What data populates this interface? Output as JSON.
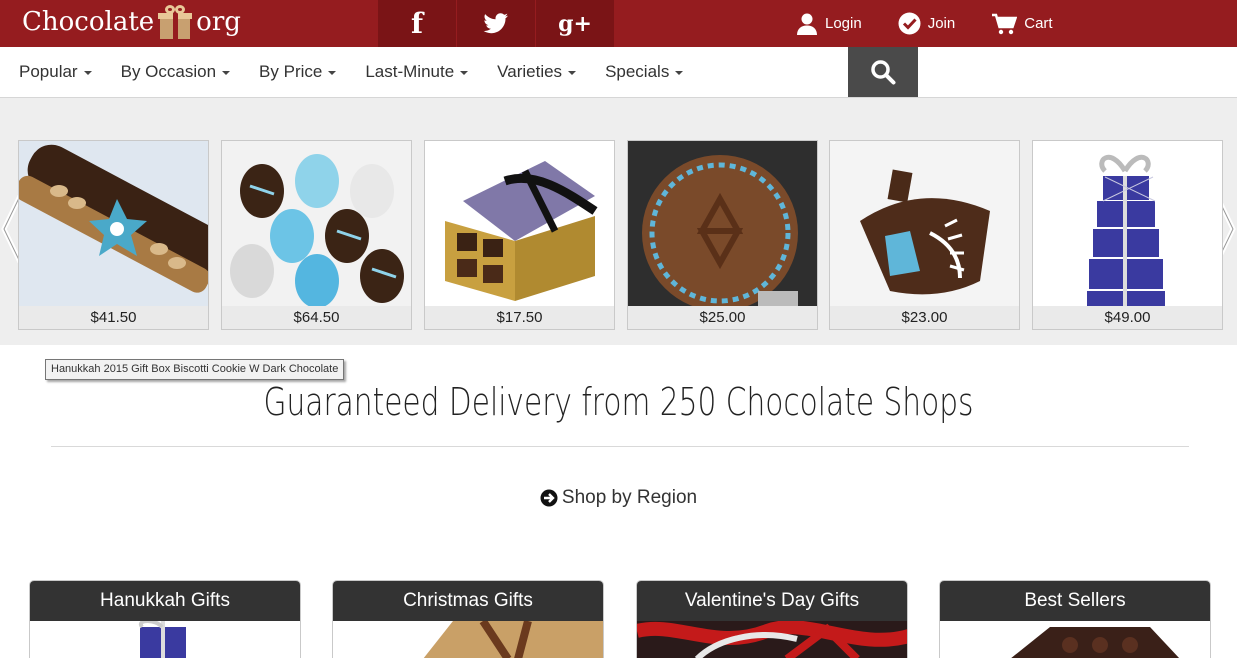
{
  "header": {
    "brand_left": "Chocolate",
    "brand_right": "org",
    "login": "Login",
    "join": "Join",
    "cart": "Cart"
  },
  "social": {
    "facebook": "f",
    "gplus": "g+"
  },
  "nav": {
    "items": [
      "Popular",
      "By Occasion",
      "By Price",
      "Last-Minute",
      "Varieties",
      "Specials"
    ]
  },
  "carousel": {
    "products": [
      {
        "price": "$41.50"
      },
      {
        "price": "$64.50"
      },
      {
        "price": "$17.50"
      },
      {
        "price": "$25.00"
      },
      {
        "price": "$23.00"
      },
      {
        "price": "$49.00"
      }
    ],
    "tooltip": "Hanukkah 2015 Gift Box Biscotti Cookie W Dark Chocolate"
  },
  "main": {
    "headline": "Guaranteed Delivery from 250 Chocolate Shops",
    "region_link": "Shop by Region"
  },
  "categories": [
    {
      "title": "Hanukkah Gifts"
    },
    {
      "title": "Christmas Gifts"
    },
    {
      "title": "Valentine's Day Gifts"
    },
    {
      "title": "Best Sellers"
    }
  ],
  "colors": {
    "brand_red": "#951c1f",
    "dark_red": "#7a1416",
    "search_bg": "#4a4a4a",
    "category_header": "#333333"
  }
}
